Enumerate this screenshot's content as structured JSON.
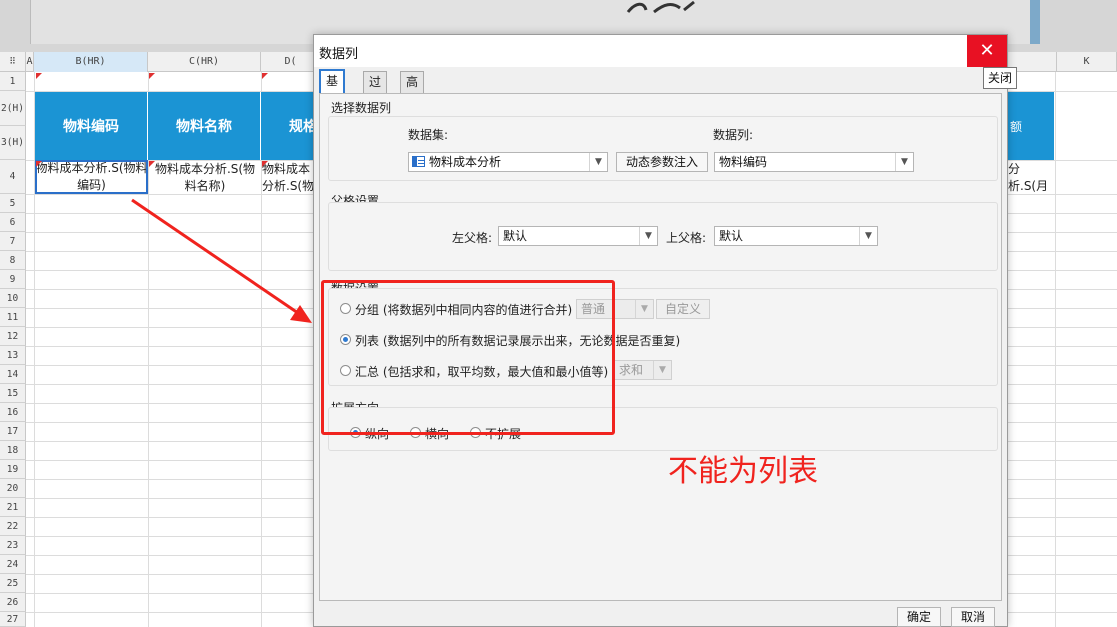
{
  "spreadsheet": {
    "columns": [
      {
        "label": "A",
        "selected": false
      },
      {
        "label": "B(HR)",
        "selected": true
      },
      {
        "label": "C(HR)",
        "selected": false
      },
      {
        "label": "D(",
        "selected": false
      },
      {
        "label": "K",
        "selected": false
      }
    ],
    "rows": [
      "1",
      "2(H)",
      "3(H)",
      "4",
      "5",
      "6",
      "7",
      "8",
      "9",
      "10",
      "11",
      "12",
      "13",
      "14",
      "15",
      "16",
      "17",
      "18",
      "19",
      "20",
      "21",
      "22",
      "23",
      "24",
      "25",
      "26",
      "27"
    ],
    "header_cells": [
      "物料编码",
      "物料名称",
      "规格",
      "额"
    ],
    "data_cells": {
      "b4": "物料成本分析.S(物料编码)",
      "c4": "物料成本分析.S(物料名称)",
      "d4": "物料成本分析.S(物料规格",
      "j4": "分析.S(月本金额)"
    },
    "header_color": "#1b94d4"
  },
  "dialog": {
    "title": "数据列",
    "close_tooltip": "关闭",
    "tabs": [
      {
        "label": "基本",
        "active": true
      },
      {
        "label": "过滤",
        "active": false
      },
      {
        "label": "高级",
        "active": false
      }
    ],
    "select_column_section": {
      "title": "选择数据列",
      "dataset_label": "数据集:",
      "dataset_value": "物料成本分析",
      "dynamic_param_button": "动态参数注入",
      "column_label": "数据列:",
      "column_value": "物料编码"
    },
    "parent_section": {
      "title": "父格设置",
      "left_label": "左父格:",
      "left_value": "默认",
      "top_label": "上父格:",
      "top_value": "默认"
    },
    "data_settings": {
      "title": "数据设置",
      "group_label": "分组 (将数据列中相同内容的值进行合并)",
      "group_mode": "普通",
      "custom_button": "自定义",
      "list_label": "列表 (数据列中的所有数据记录展示出来，无论数据是否重复)",
      "summary_label": "汇总 (包括求和，取平均数，最大值和最小值等)",
      "summary_mode": "求和",
      "selected": "list"
    },
    "expand_direction": {
      "title": "扩展方向",
      "options": [
        "纵向",
        "横向",
        "不扩展"
      ],
      "selected": "纵向"
    },
    "ok_button": "确定",
    "cancel_button": "取消"
  },
  "annotation": {
    "text": "不能为列表",
    "color": "#f0231e"
  }
}
